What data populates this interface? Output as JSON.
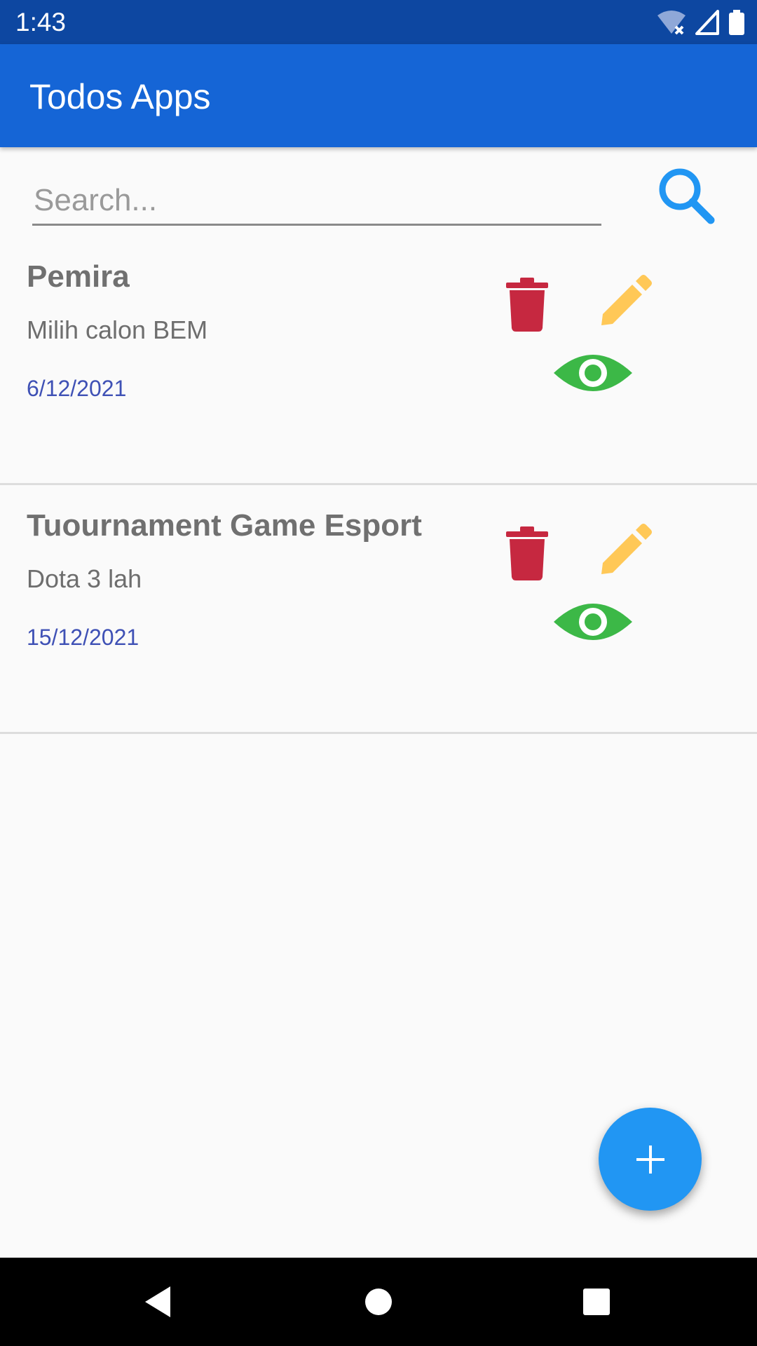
{
  "status_bar": {
    "time": "1:43",
    "icons": [
      "wifi-off-icon",
      "signal-icon",
      "battery-icon"
    ]
  },
  "app_bar": {
    "title": "Todos Apps"
  },
  "search": {
    "placeholder": "Search...",
    "value": "",
    "icon": "search-icon"
  },
  "todos": [
    {
      "title": "Pemira",
      "description": "Milih calon BEM",
      "date": "6/12/2021"
    },
    {
      "title": "Tuournament Game Esport",
      "description": "Dota 3 lah",
      "date": "15/12/2021"
    }
  ],
  "actions": {
    "delete_icon": "trash-icon",
    "edit_icon": "pencil-icon",
    "view_icon": "eye-icon"
  },
  "fab": {
    "icon": "plus-icon"
  },
  "nav_bar": {
    "buttons": [
      "back-icon",
      "home-icon",
      "recents-icon"
    ]
  },
  "colors": {
    "status_bar": "#0d47a1",
    "app_bar": "#1565d6",
    "accent": "#2196f3",
    "delete": "#c62840",
    "edit": "#ffc857",
    "view": "#3cb847",
    "date": "#3f51b5"
  }
}
